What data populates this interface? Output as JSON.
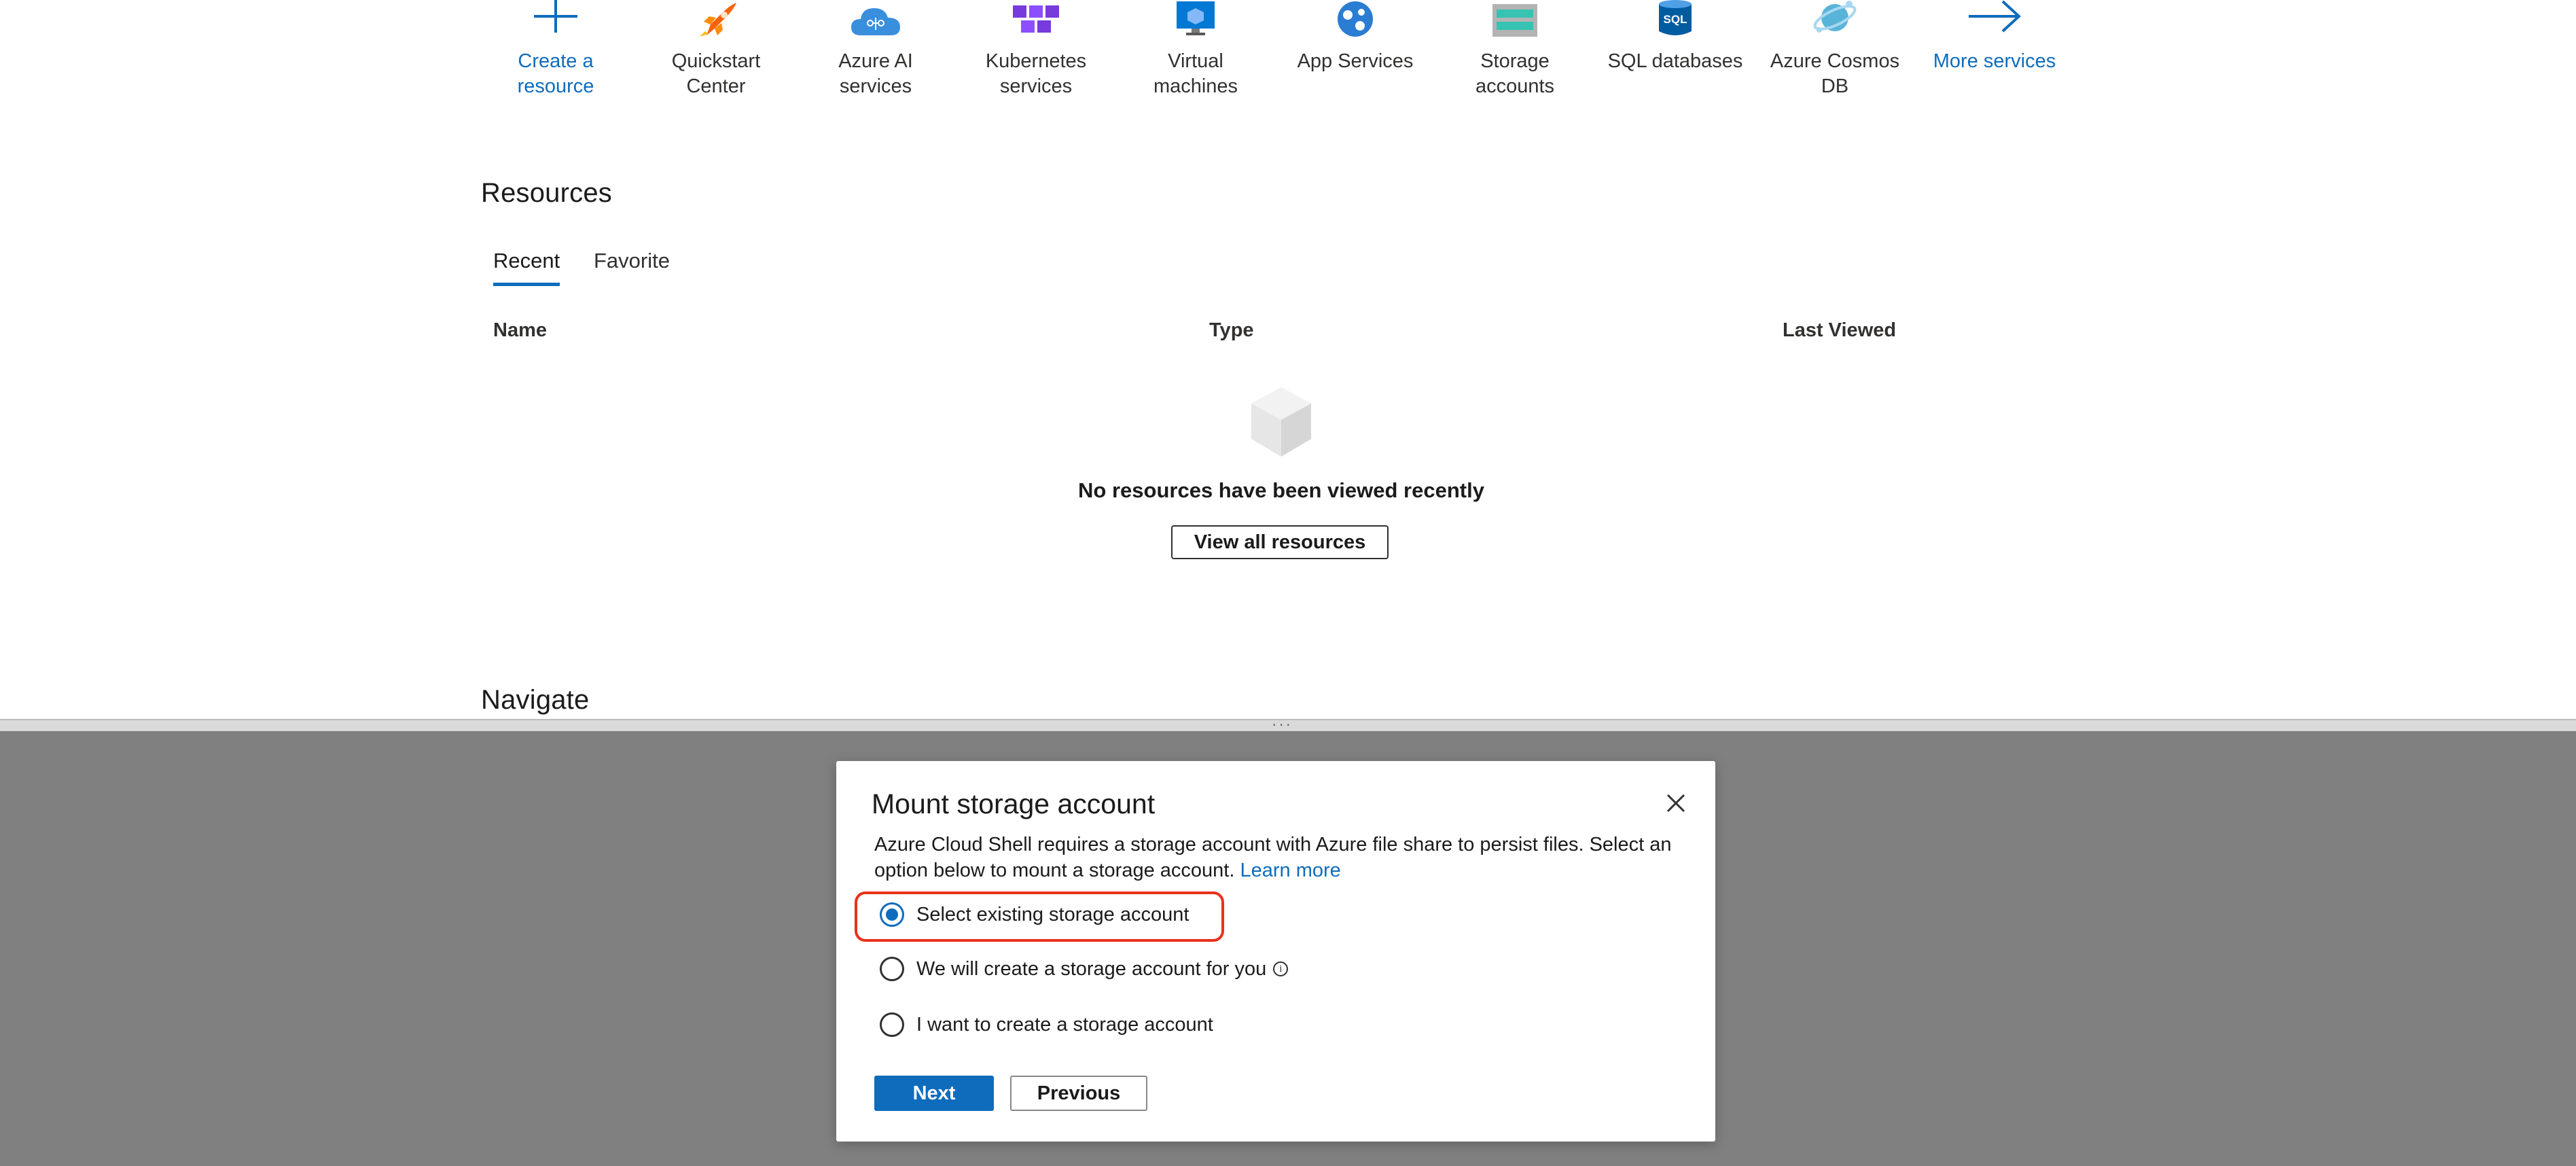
{
  "services": [
    {
      "label": "Create a\nresource",
      "icon": "plus-icon",
      "is_link": true
    },
    {
      "label": "Quickstart\nCenter",
      "icon": "rocket-icon",
      "is_link": false
    },
    {
      "label": "Azure AI\nservices",
      "icon": "cloud-ai-icon",
      "is_link": false
    },
    {
      "label": "Kubernetes\nservices",
      "icon": "kubernetes-icon",
      "is_link": false
    },
    {
      "label": "Virtual\nmachines",
      "icon": "virtual-machine-icon",
      "is_link": false
    },
    {
      "label": "App Services",
      "icon": "app-services-icon",
      "is_link": false
    },
    {
      "label": "Storage\naccounts",
      "icon": "storage-icon",
      "is_link": false
    },
    {
      "label": "SQL databases",
      "icon": "sql-database-icon",
      "is_link": false
    },
    {
      "label": "Azure Cosmos\nDB",
      "icon": "cosmos-db-icon",
      "is_link": false
    },
    {
      "label": "More services",
      "icon": "arrow-right-icon",
      "is_link": true
    }
  ],
  "resources": {
    "title": "Resources",
    "tabs": [
      {
        "label": "Recent",
        "active": true
      },
      {
        "label": "Favorite",
        "active": false
      }
    ],
    "columns": [
      "Name",
      "Type",
      "Last Viewed"
    ],
    "empty_message": "No resources have been viewed recently",
    "view_all_label": "View all resources",
    "empty_icon": "cube-icon"
  },
  "navigate": {
    "title": "Navigate"
  },
  "splitter": {
    "dots": "···"
  },
  "dialog": {
    "title": "Mount storage account",
    "description": "Azure Cloud Shell requires a storage account with Azure file share to persist files. Select an option below to mount a storage account.",
    "learn_more": "Learn more",
    "options": [
      {
        "label": "Select existing storage account",
        "checked": true
      },
      {
        "label": "We will create a storage account for you",
        "checked": false,
        "info": "i"
      },
      {
        "label": "I want to create a storage account",
        "checked": false
      }
    ],
    "next_label": "Next",
    "previous_label": "Previous"
  },
  "colors": {
    "accent": "#0f6cbd",
    "highlight_border": "#e8311a",
    "shell_background": "#808080"
  }
}
